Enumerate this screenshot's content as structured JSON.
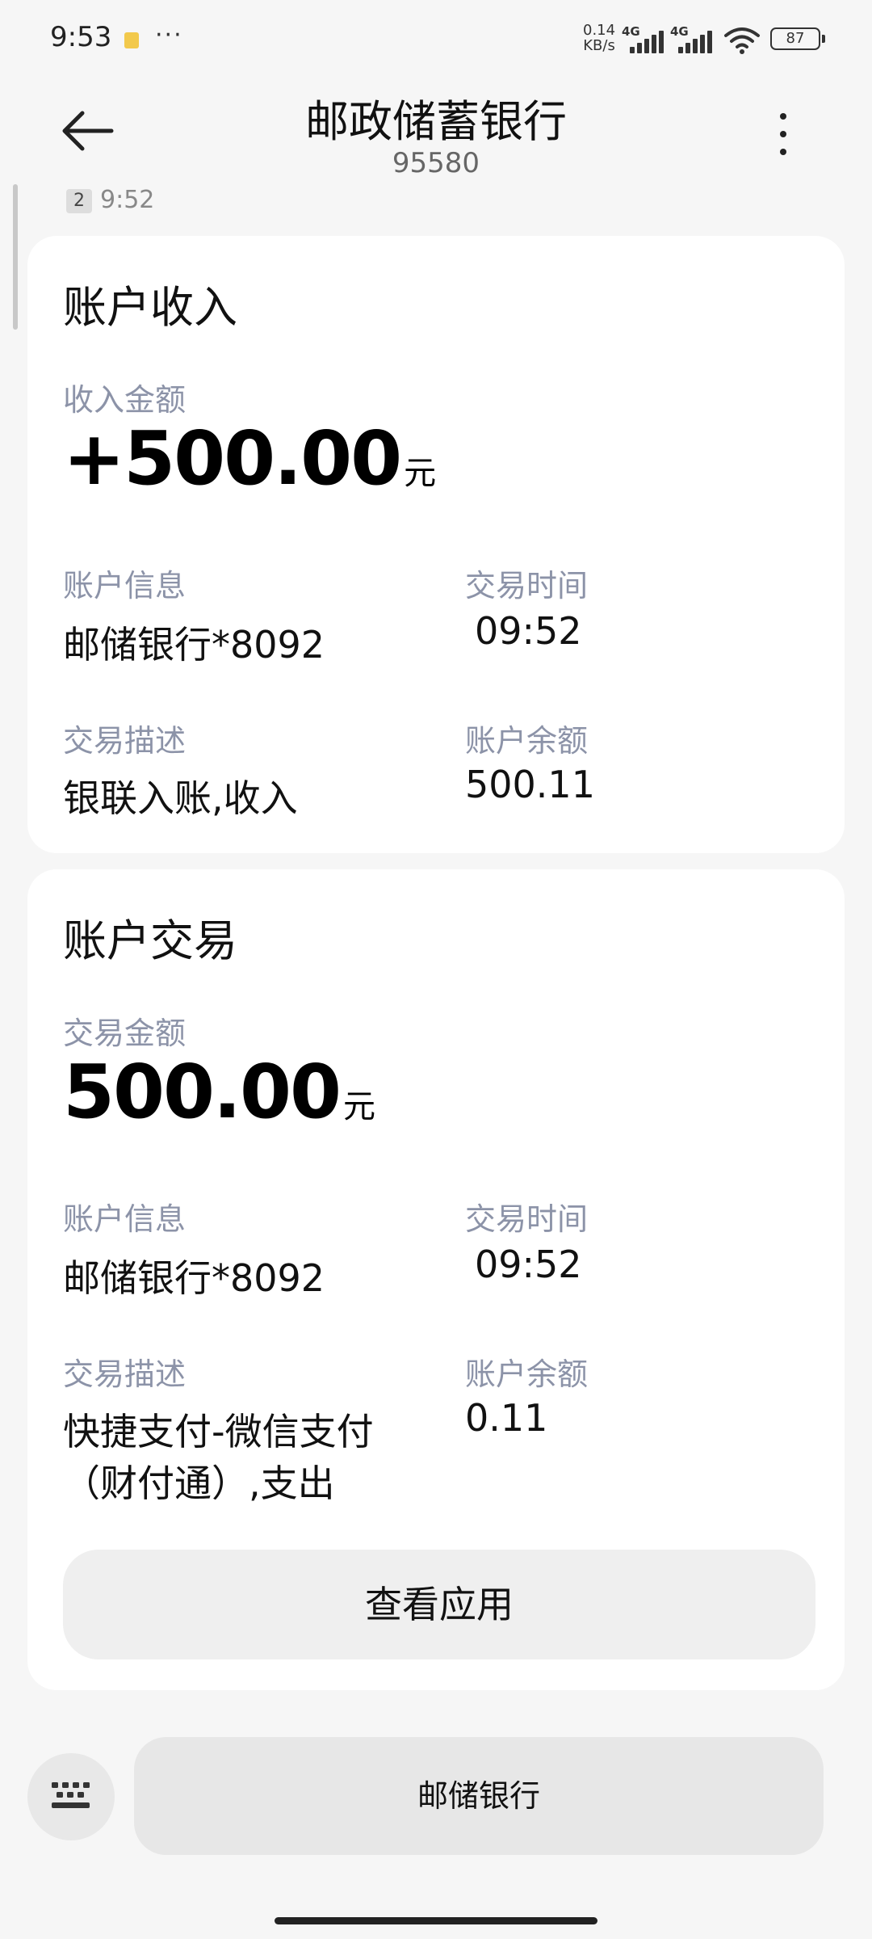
{
  "status_bar": {
    "time": "9:53",
    "more": "···",
    "net_speed_value": "0.14",
    "net_speed_unit": "KB/s",
    "signal_1": "4G",
    "signal_2": "4G",
    "battery": "87",
    "icons": [
      "sim-icon",
      "more-dots-icon",
      "signal-icon",
      "wifi-icon",
      "battery-icon"
    ]
  },
  "header": {
    "title": "邮政储蓄银行",
    "subtitle": "95580",
    "icons": [
      "back-arrow-icon",
      "more-vertical-icon"
    ]
  },
  "previous_message": {
    "badge": "2",
    "time": "9:52"
  },
  "cards": [
    {
      "title": "账户收入",
      "amount_label": "收入金额",
      "amount": "+500.00",
      "unit": "元",
      "account_label": "账户信息",
      "account": "邮储银行*8092",
      "time_label": "交易时间",
      "time": "09:52",
      "desc_label": "交易描述",
      "desc": "银联入账,收入",
      "balance_label": "账户余额",
      "balance": "500.11"
    },
    {
      "title": "账户交易",
      "amount_label": "交易金额",
      "amount": "500.00",
      "unit": "元",
      "account_label": "账户信息",
      "account": "邮储银行*8092",
      "time_label": "交易时间",
      "time": "09:52",
      "desc_label": "交易描述",
      "desc_line1": "快捷支付-微信支付",
      "desc_line2": "（财付通）,支出",
      "balance_label": "账户余额",
      "balance": "0.11",
      "button": "查看应用"
    }
  ],
  "bottom_bar": {
    "quick_reply": "邮储银行",
    "icons": [
      "keyboard-icon"
    ]
  }
}
